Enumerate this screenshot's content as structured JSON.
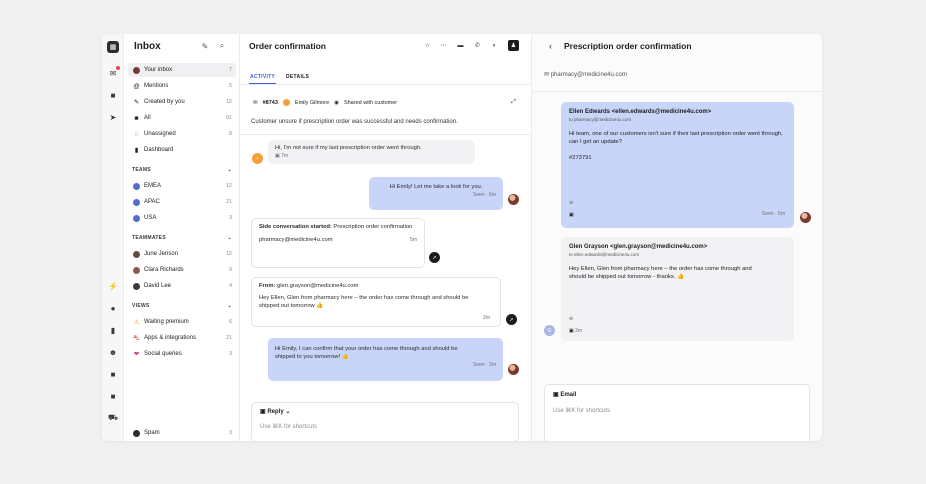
{
  "sidebar": {
    "title": "Inbox",
    "items": [
      {
        "label": "Your inbox",
        "count": "7"
      },
      {
        "label": "Mentions",
        "count": "5"
      },
      {
        "label": "Created by you",
        "count": "12"
      },
      {
        "label": "All",
        "count": "91"
      },
      {
        "label": "Unassigned",
        "count": "8"
      },
      {
        "label": "Dashboard",
        "count": ""
      }
    ],
    "teams_header": "TEAMS",
    "teams": [
      {
        "label": "EMEA",
        "count": "12"
      },
      {
        "label": "APAC",
        "count": "21"
      },
      {
        "label": "USA",
        "count": "3"
      }
    ],
    "teammates_header": "TEAMMATES",
    "teammates": [
      {
        "label": "June Jenson",
        "count": "12"
      },
      {
        "label": "Clara Richards",
        "count": "9"
      },
      {
        "label": "David Lee",
        "count": "4"
      }
    ],
    "views_header": "VIEWS",
    "views": [
      {
        "label": "Waiting premium",
        "count": "6"
      },
      {
        "label": "Apps & integrations",
        "count": "21"
      },
      {
        "label": "Social queries",
        "count": "3"
      }
    ],
    "spam": {
      "label": "Spam",
      "count": "3"
    }
  },
  "conversation": {
    "title": "Order confirmation",
    "tabs": [
      "ACTIVITY",
      "DETAILS"
    ],
    "ticket_id": "#8743",
    "assignee": "Emily Gilmore",
    "shared": "Shared with customer",
    "summary": "Customer unsure if prescription order was successful and needs confirmation.",
    "messages": {
      "m1_text": "Hi, I'm not sure if my last prescription order went through.",
      "m1_time": "7m",
      "m2_text": "Hi Emily! Let me take a look for you.",
      "m2_time": "Seen · 6m",
      "m3_bold": "Side conversation started:",
      "m3_text": " Prescription order confirmation",
      "m3_email": "pharmacy@medicine4u.com",
      "m3_time": "5m",
      "m4_from_label": "From:",
      "m4_from": " glen.grayson@medicine4u.com",
      "m4_text": "Hey Ellen, Glen from pharmacy here – the order has come through and should be shipped out tomorrow 👍",
      "m4_time": "2m",
      "m5_text": "Hi Emily, I can confirm that your order has come through and should be shipped to you tomorrow! 👍",
      "m5_time": "Seen · 2m"
    },
    "reply_label": "Reply",
    "reply_placeholder": "Use ⌘K for shortcuts"
  },
  "side_conversation": {
    "title": "Prescription order confirmation",
    "recipient": "pharmacy@medicine4u.com",
    "email1_from": "Ellen Edwards <ellen.edwards@medicine4u.com>",
    "email1_to": "to pharmacy@medicine4u.com",
    "email1_body": "Hi team, one of our customers isn't sure if their last prescription order went through, can I get an update?",
    "email1_ref": "#273791",
    "email1_time": "Seen · 5m",
    "email2_from": "Glen Grayson <glen.grayson@medicine4u.com>",
    "email2_to": "to ellen.edwards@medicine4u.com",
    "email2_body": "Hey Ellen, Glen from pharmacy here – the order has come through and should be shipped out tomorrow - thanks. 👍",
    "email2_time": "2m",
    "compose_label": "Email",
    "compose_placeholder": "Use ⌘K for shortcuts"
  },
  "colors": {
    "accent": "#3b5bdb",
    "outgoing_bubble": "#c9d5f8",
    "background": "#f0f0f1"
  }
}
